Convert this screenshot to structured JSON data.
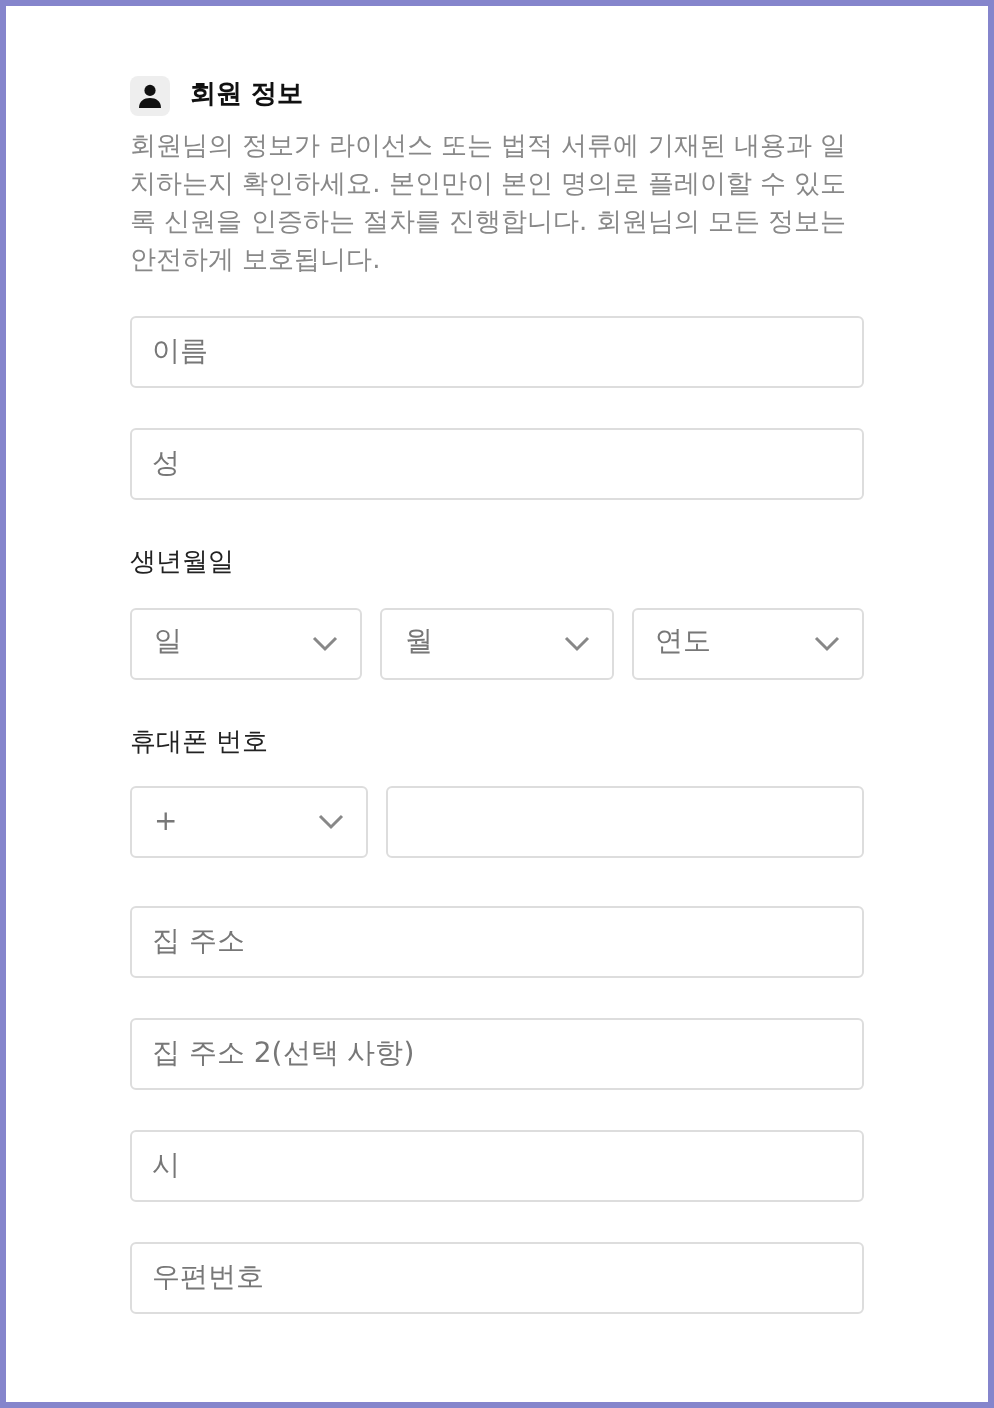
{
  "header": {
    "title": "회원 정보",
    "description": "회원님의 정보가 라이선스 또는 법적 서류에 기재된 내용과 일치하는지 확인하세요. 본인만이 본인 명의로 플레이할 수 있도록 신원을 인증하는 절차를 진행합니다. 회원님의 모든 정보는 안전하게 보호됩니다."
  },
  "items": [
    {
      "kind": "field",
      "placeholder": "이름"
    },
    {
      "kind": "field",
      "placeholder": "성"
    },
    {
      "kind": "label",
      "text": "생년월일"
    },
    {
      "kind": "selects",
      "options": [
        {
          "placeholder": "일"
        },
        {
          "placeholder": "월"
        },
        {
          "placeholder": "연도"
        }
      ]
    },
    {
      "kind": "label",
      "text": "휴대폰 번호"
    },
    {
      "kind": "phone",
      "code": "+"
    },
    {
      "kind": "field",
      "placeholder": "집 주소"
    },
    {
      "kind": "field",
      "placeholder": "집 주소 2(선택 사항)"
    },
    {
      "kind": "field",
      "placeholder": "시"
    },
    {
      "kind": "field",
      "placeholder": "우편번호"
    }
  ]
}
